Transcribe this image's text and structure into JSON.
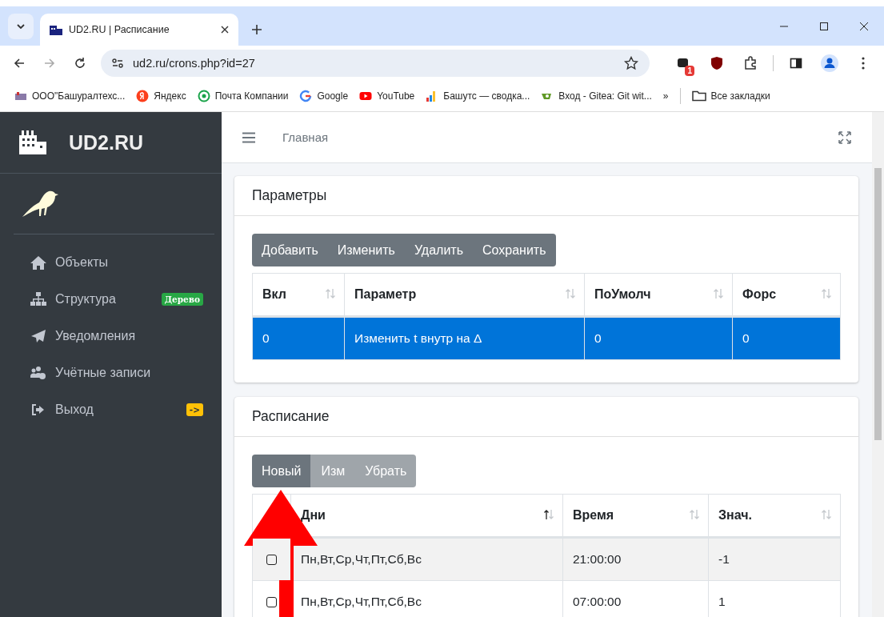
{
  "browser": {
    "tabs": [
      {
        "title": "UD2.RU | Расписание",
        "selected": true
      }
    ],
    "address": "ud2.ru/crons.php?id=27",
    "extension_badge": "1",
    "bookmarks": [
      {
        "label": "ООО\"Башуралтехс...",
        "kind": "site"
      },
      {
        "label": "Яндекс",
        "kind": "yandex"
      },
      {
        "label": "Почта Компании",
        "kind": "mail"
      },
      {
        "label": "Google",
        "kind": "google"
      },
      {
        "label": "YouTube",
        "kind": "youtube"
      },
      {
        "label": "Башутс — сводка...",
        "kind": "chart"
      },
      {
        "label": "Вход - Gitea: Git wit...",
        "kind": "gitea"
      }
    ],
    "more": "»",
    "all_bookmarks": "Все закладки"
  },
  "sidebar": {
    "brand": "UD2.RU",
    "items": [
      {
        "label": "Объекты",
        "kind": "home"
      },
      {
        "label": "Структура",
        "kind": "sitemap",
        "badge": "Дерево",
        "color": "#28a745"
      },
      {
        "label": "Уведомления",
        "kind": "plane"
      },
      {
        "label": "Учётные записи",
        "kind": "users"
      },
      {
        "label": "Выход",
        "kind": "exit",
        "badge": "->",
        "color": "#ffc107"
      }
    ]
  },
  "header": {
    "breadcrumb": "Главная"
  },
  "cards": [
    {
      "title": "Параметры",
      "buttons": [
        {
          "label": "Добавить",
          "disabled": false
        },
        {
          "label": "Изменить",
          "disabled": false
        },
        {
          "label": "Удалить",
          "disabled": false
        },
        {
          "label": "Сохранить",
          "disabled": false
        }
      ],
      "columns": [
        {
          "label": "Вкл",
          "sorted": false
        },
        {
          "label": "Параметр",
          "sorted": false
        },
        {
          "label": "ПоУмолч",
          "sorted": false
        },
        {
          "label": "Форс",
          "sorted": false
        }
      ],
      "rows": [
        {
          "cells": [
            "0",
            "Изменить t внутр на Δ",
            "0",
            "0"
          ],
          "selected": true
        }
      ]
    },
    {
      "title": "Расписание",
      "buttons": [
        {
          "label": "Новый",
          "disabled": false
        },
        {
          "label": "Изм",
          "disabled": true
        },
        {
          "label": "Убрать",
          "disabled": true
        }
      ],
      "columns": [
        {
          "label": "Дни",
          "sorted": true
        },
        {
          "label": "Время",
          "sorted": false
        },
        {
          "label": "Знач.",
          "sorted": false
        }
      ],
      "rows": [
        {
          "cells": [
            "Пн,Вт,Ср,Чт,Пт,Сб,Вс",
            "21:00:00",
            "-1"
          ],
          "selected": false,
          "checked": false,
          "striped": true
        },
        {
          "cells": [
            "Пн,Вт,Ср,Чт,Пт,Сб,Вс",
            "07:00:00",
            "1"
          ],
          "selected": false,
          "checked": false,
          "striped": false
        }
      ]
    }
  ]
}
